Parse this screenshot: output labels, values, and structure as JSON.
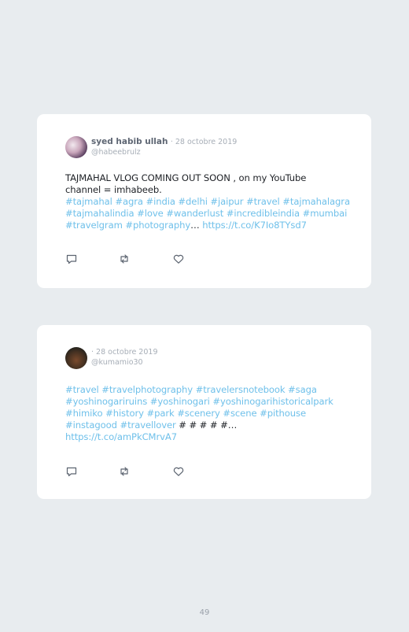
{
  "tweets": [
    {
      "author": "syed habib ullah",
      "date": "· 28 octobre 2019",
      "handle": "@habeebrulz",
      "lines": [
        [
          {
            "text": "TAJMAHAL VLOG COMING OUT SOON , on my YouTube",
            "type": "text"
          }
        ],
        [
          {
            "text": "channel = imhabeeb.",
            "type": "text"
          }
        ],
        [
          {
            "text": "#tajmahal #agra #india #delhi #jaipur #travel #tajmahalagra",
            "type": "link"
          }
        ],
        [
          {
            "text": "#tajmahalindia #love #wanderlust #incredibleindia #mumbai",
            "type": "link"
          }
        ],
        [
          {
            "text": "#travelgram #photography",
            "type": "link"
          },
          {
            "text": "… ",
            "type": "text"
          },
          {
            "text": "https://t.co/K7Io8TYsd7",
            "type": "link"
          }
        ]
      ],
      "avatar_icon": "user-avatar-photo"
    },
    {
      "author": "",
      "date": "· 28 octobre 2019",
      "handle": "@kumamio30",
      "lines": [
        [
          {
            "text": "#travel #travelphotography #travelersnotebook #saga",
            "type": "link"
          }
        ],
        [
          {
            "text": "#yoshinogariruins #yoshinogari #yoshinogarihistoricalpark",
            "type": "link"
          }
        ],
        [
          {
            "text": "#himiko #history #park #scenery #scene #pithouse",
            "type": "link"
          }
        ],
        [
          {
            "text": "#instagood #travellover ",
            "type": "link"
          },
          {
            "text": "# # # # #…",
            "type": "text"
          }
        ],
        [
          {
            "text": "https://t.co/amPkCMrvA7",
            "type": "link"
          }
        ]
      ],
      "avatar_icon": "user-avatar-photo"
    }
  ],
  "actions": [
    "reply-icon",
    "retweet-icon",
    "like-icon"
  ],
  "colors": {
    "background": "#e8ecef",
    "card": "#ffffff",
    "link": "#6fc0ea",
    "text": "#1e2126",
    "muted": "#a7aeb7"
  },
  "page_number": "49"
}
